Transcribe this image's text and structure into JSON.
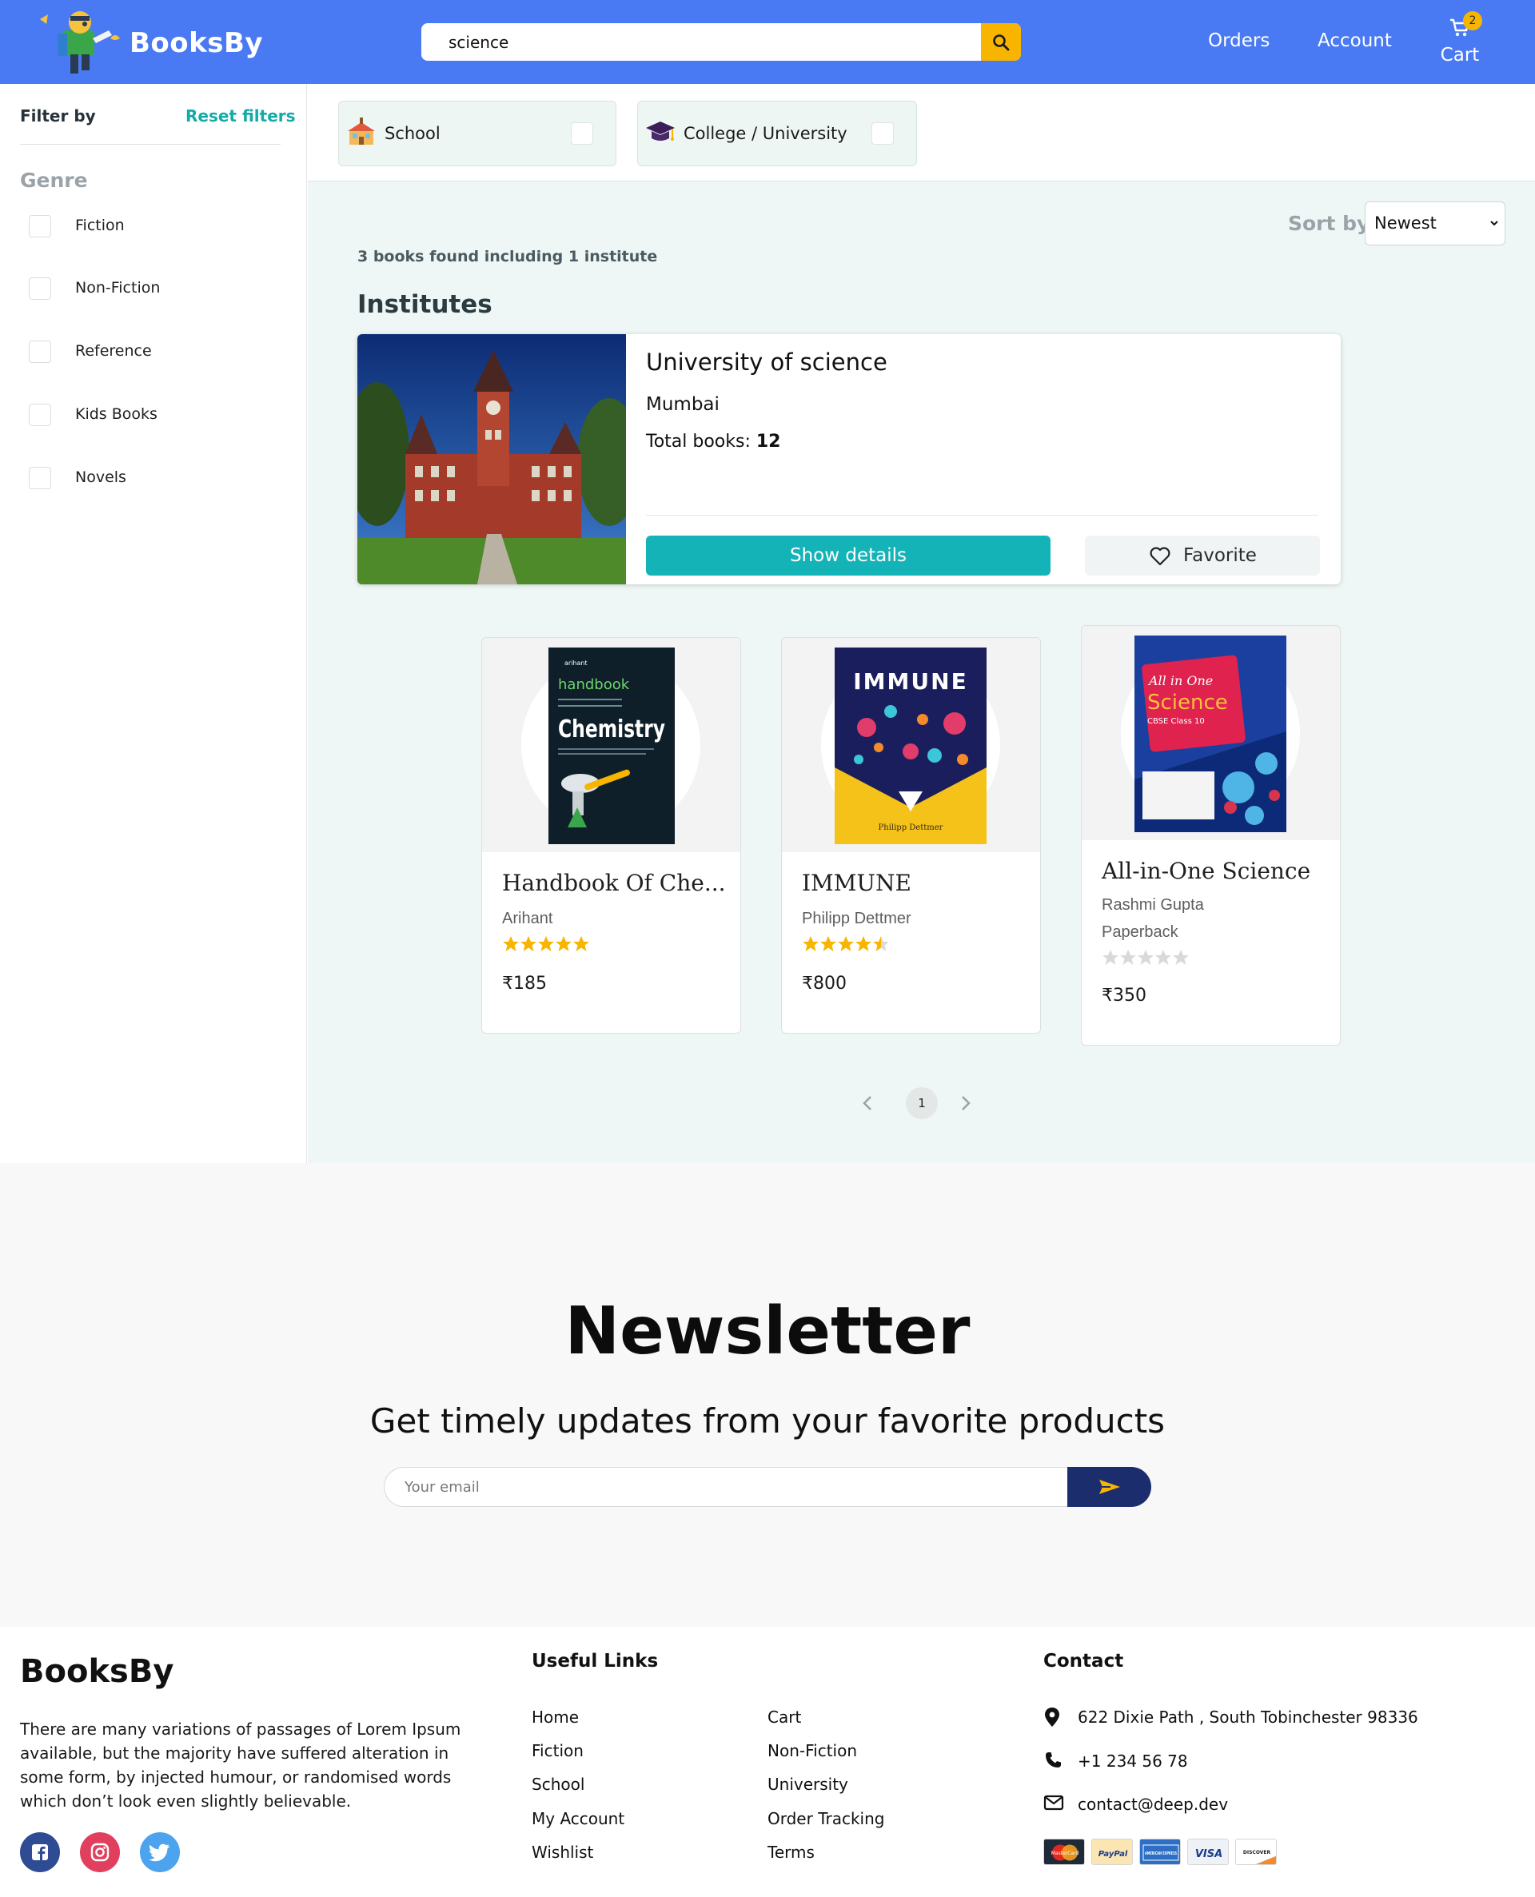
{
  "header": {
    "brand": "BooksBy",
    "search": {
      "value": "science",
      "placeholder": ""
    },
    "nav": {
      "orders": "Orders",
      "account": "Account",
      "cart": "Cart",
      "cart_count": "2"
    },
    "colors": {
      "bar": "#4a7af3",
      "accent": "#f7b500"
    }
  },
  "sidebar": {
    "filter_by": "Filter by",
    "reset_filters": "Reset filters",
    "genre_heading": "Genre",
    "genres": [
      "Fiction",
      "Non-Fiction",
      "Reference",
      "Kids Books",
      "Novels"
    ]
  },
  "main": {
    "types": [
      {
        "label": "School",
        "icon": "school-icon",
        "checked": false
      },
      {
        "label": "College / University",
        "icon": "graduation-cap-icon",
        "checked": false
      }
    ],
    "sort": {
      "label": "Sort by",
      "value": "Newest"
    },
    "results_count": "3 books found including 1 institute",
    "institutes_heading": "Institutes",
    "institute": {
      "name": "University of science",
      "city": "Mumbai",
      "total_label": "Total books:",
      "total_value": "12",
      "show_details": "Show details",
      "favorite": "Favorite"
    },
    "books": [
      {
        "title": "Handbook Of Che...",
        "author": "Arihant",
        "format": "",
        "rating": 5,
        "price": "₹185",
        "cover_text": [
          "arihant",
          "handbook",
          "Chemistry"
        ]
      },
      {
        "title": "IMMUNE",
        "author": "Philipp Dettmer",
        "format": "",
        "rating": 4.5,
        "price": "₹800",
        "cover_text": [
          "IMMUNE",
          "Philipp Dettmer"
        ]
      },
      {
        "title": "All-in-One Science",
        "author": "Rashmi Gupta",
        "format": "Paperback",
        "rating": 0,
        "price": "₹350",
        "cover_text": [
          "All in One",
          "Science",
          "CBSE Class 10"
        ]
      }
    ],
    "pagination": {
      "current": "1"
    }
  },
  "newsletter": {
    "title": "Newsletter",
    "subtitle": "Get timely updates from your favorite products",
    "email_placeholder": "Your email"
  },
  "footer": {
    "brand": "BooksBy",
    "about": "There are many variations of passages of Lorem Ipsum available, but the majority have suffered alteration in some form, by injected humour, or randomised words which don’t look even slightly believable.",
    "social": [
      "facebook-icon",
      "instagram-icon",
      "twitter-icon"
    ],
    "useful_links_heading": "Useful Links",
    "links_col1": [
      "Home",
      "Fiction",
      "School",
      "My Account",
      "Wishlist"
    ],
    "links_col2": [
      "Cart",
      "Non-Fiction",
      "University",
      "Order Tracking",
      "Terms"
    ],
    "contact_heading": "Contact",
    "address": "622 Dixie Path , South Tobinchester 98336",
    "phone": "+1 234 56 78",
    "email": "contact@deep.dev",
    "payments": [
      "MasterCard",
      "PayPal",
      "AMERICAN EXPRESS",
      "VISA",
      "DISCOVER"
    ]
  }
}
